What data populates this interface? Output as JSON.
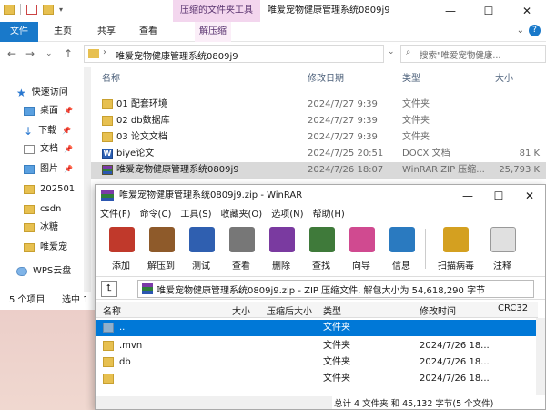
{
  "explorer": {
    "window_title": "唯爱宠物健康管理系统0809j9",
    "context_tab_group": "压缩的文件夹工具",
    "ribbon_tabs": [
      "文件",
      "主页",
      "共享",
      "查看",
      "解压缩"
    ],
    "address_path": "唯爱宠物健康管理系统0809j9",
    "search_placeholder": "搜索\"唯爱宠物健康...",
    "columns": {
      "name": "名称",
      "date": "修改日期",
      "type": "类型",
      "size": "大小"
    },
    "sidebar": [
      {
        "label": "快速访问",
        "icon": "star-icon"
      },
      {
        "label": "桌面",
        "icon": "desktop-icon"
      },
      {
        "label": "下载",
        "icon": "download-icon"
      },
      {
        "label": "文档",
        "icon": "document-icon"
      },
      {
        "label": "图片",
        "icon": "picture-icon"
      },
      {
        "label": "202501",
        "icon": "folder-icon"
      },
      {
        "label": "csdn",
        "icon": "folder-icon"
      },
      {
        "label": "冰糖",
        "icon": "folder-icon"
      },
      {
        "label": "唯爱宠",
        "icon": "folder-icon"
      },
      {
        "label": "WPS云盘",
        "icon": "cloud-icon"
      }
    ],
    "files": [
      {
        "name": "01 配套环境",
        "date": "2024/7/27 9:39",
        "type": "文件夹",
        "size": "",
        "icon": "folder-icon"
      },
      {
        "name": "02 db数据库",
        "date": "2024/7/27 9:39",
        "type": "文件夹",
        "size": "",
        "icon": "folder-icon"
      },
      {
        "name": "03 论文文档",
        "date": "2024/7/27 9:39",
        "type": "文件夹",
        "size": "",
        "icon": "folder-icon"
      },
      {
        "name": "biye论文",
        "date": "2024/7/25 20:51",
        "type": "DOCX 文档",
        "size": "81 KI",
        "icon": "word-icon"
      },
      {
        "name": "唯爱宠物健康管理系统0809j9",
        "date": "2024/7/26 18:07",
        "type": "WinRAR ZIP 压缩...",
        "size": "25,793 KI",
        "icon": "zip-icon"
      }
    ],
    "status_items": "5 个项目",
    "status_selected": "选中 1"
  },
  "winrar": {
    "title": "唯爱宠物健康管理系统0809j9.zip - WinRAR",
    "menu": [
      "文件(F)",
      "命令(C)",
      "工具(S)",
      "收藏夹(O)",
      "选项(N)",
      "帮助(H)"
    ],
    "tools": [
      {
        "label": "添加",
        "color": "#c0392b"
      },
      {
        "label": "解压到",
        "color": "#8e5a2a"
      },
      {
        "label": "测试",
        "color": "#2f5fb0"
      },
      {
        "label": "查看",
        "color": "#666666"
      },
      {
        "label": "删除",
        "color": "#7a3aa0"
      },
      {
        "label": "查找",
        "color": "#3f7a3a"
      },
      {
        "label": "向导",
        "color": "#d04a90"
      },
      {
        "label": "信息",
        "color": "#2a7ac0"
      },
      {
        "label": "扫描病毒",
        "color": "#d4a020"
      },
      {
        "label": "注释",
        "color": "#999999"
      }
    ],
    "path_text": "唯爱宠物健康管理系统0809j9.zip - ZIP 压缩文件, 解包大小为 54,618,290 字节",
    "columns": {
      "name": "名称",
      "size": "大小",
      "packed": "压缩后大小",
      "type": "类型",
      "modified": "修改时间",
      "crc": "CRC32"
    },
    "rows": [
      {
        "name": "..",
        "type": "文件夹",
        "modified": ""
      },
      {
        "name": ".mvn",
        "type": "文件夹",
        "modified": "2024/7/26 18..."
      },
      {
        "name": "db",
        "type": "文件夹",
        "modified": "2024/7/26 18..."
      },
      {
        "name": "",
        "type": "文件夹",
        "modified": "2024/7/26 18..."
      }
    ],
    "status": "总计 4 文件夹 和 45,132 字节(5 个文件)"
  }
}
